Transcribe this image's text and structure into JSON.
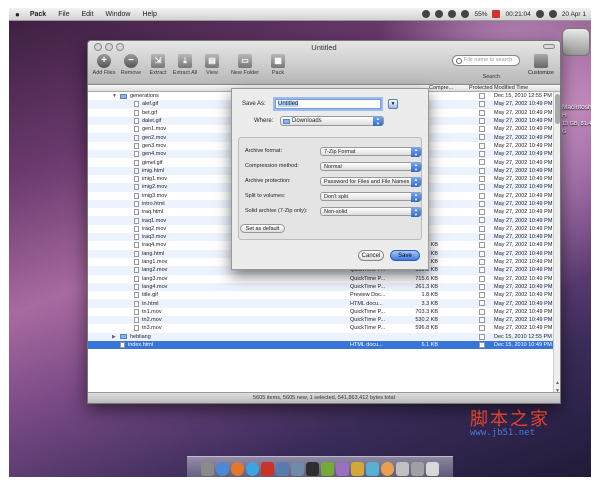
{
  "menubar": {
    "app": "Pack",
    "menus": [
      "File",
      "Edit",
      "Window",
      "Help"
    ],
    "battery": "55%",
    "clock": "00:21:04",
    "date": "20 Apr 1"
  },
  "desktop": {
    "drive_label_1": "Macintosh H",
    "drive_label_2": "13 GB, 81.4 G"
  },
  "window": {
    "title": "Untitled",
    "toolbar": [
      {
        "label": "Add Files",
        "glyph": "+"
      },
      {
        "label": "Remove",
        "glyph": "−"
      },
      {
        "label": "Extract",
        "glyph": "⇲"
      },
      {
        "label": "Extract All",
        "glyph": "⤓"
      },
      {
        "label": "View",
        "glyph": "▤"
      },
      {
        "label": "New Folder",
        "glyph": "▭"
      },
      {
        "label": "Pack",
        "glyph": "▦"
      }
    ],
    "search_placeholder": "File name to search",
    "search_label": "Search",
    "customize_label": "Customize",
    "columns": {
      "compression": "Compre...",
      "protected": "Protected",
      "modified": "Modified Time"
    },
    "status": "5605 items, 5605 new, 1 selected, 541,863,412 bytes total"
  },
  "rows": [
    {
      "name": "generations",
      "folder": true,
      "open": true,
      "indent": 0,
      "kind": "",
      "size": "",
      "modified": "Dec 15, 2010 12:55 PM"
    },
    {
      "name": "alef.gif",
      "indent": 1,
      "kind": "",
      "size": "",
      "modified": "May 27, 2002 10:49 PM"
    },
    {
      "name": "bet.gif",
      "indent": 1,
      "kind": "",
      "size": "",
      "modified": "May 27, 2002 10:49 PM"
    },
    {
      "name": "dalet.gif",
      "indent": 1,
      "kind": "",
      "size": "",
      "modified": "May 27, 2002 10:49 PM"
    },
    {
      "name": "gen1.mov",
      "indent": 1,
      "kind": "",
      "size": "",
      "modified": "May 27, 2002 10:49 PM"
    },
    {
      "name": "gen2.mov",
      "indent": 1,
      "kind": "",
      "size": "",
      "modified": "May 27, 2002 10:49 PM"
    },
    {
      "name": "gen3.mov",
      "indent": 1,
      "kind": "",
      "size": "",
      "modified": "May 27, 2002 10:49 PM"
    },
    {
      "name": "gen4.mov",
      "indent": 1,
      "kind": "",
      "size": "",
      "modified": "May 27, 2002 10:49 PM"
    },
    {
      "name": "gimel.gif",
      "indent": 1,
      "kind": "",
      "size": "",
      "modified": "May 27, 2002 10:49 PM"
    },
    {
      "name": "imig.html",
      "indent": 1,
      "kind": "",
      "size": "",
      "modified": "May 27, 2002 10:49 PM"
    },
    {
      "name": "imig1.mov",
      "indent": 1,
      "kind": "",
      "size": "",
      "modified": "May 27, 2002 10:49 PM"
    },
    {
      "name": "imig2.mov",
      "indent": 1,
      "kind": "",
      "size": "",
      "modified": "May 27, 2002 10:49 PM"
    },
    {
      "name": "imig3.mov",
      "indent": 1,
      "kind": "",
      "size": "",
      "modified": "May 27, 2002 10:49 PM"
    },
    {
      "name": "intro.html",
      "indent": 1,
      "kind": "",
      "size": "",
      "modified": "May 27, 2002 10:49 PM"
    },
    {
      "name": "iraq.html",
      "indent": 1,
      "kind": "",
      "size": "",
      "modified": "May 27, 2002 10:49 PM"
    },
    {
      "name": "iraq1.mov",
      "indent": 1,
      "kind": "",
      "size": "",
      "modified": "May 27, 2002 10:49 PM"
    },
    {
      "name": "iraq2.mov",
      "indent": 1,
      "kind": "",
      "size": "",
      "modified": "May 27, 2002 10:49 PM"
    },
    {
      "name": "iraq3.mov",
      "indent": 1,
      "kind": "",
      "size": "",
      "modified": "May 27, 2002 10:49 PM"
    },
    {
      "name": "iraq4.mov",
      "indent": 1,
      "kind": "QuickTime P...",
      "size": "400.1 KB",
      "modified": "May 27, 2002 10:49 PM"
    },
    {
      "name": "lang.html",
      "indent": 1,
      "kind": "HTML docu...",
      "size": "4.1 KB",
      "modified": "May 27, 2002 10:49 PM"
    },
    {
      "name": "lang1.mov",
      "indent": 1,
      "kind": "QuickTime P...",
      "size": "555.8 KB",
      "modified": "May 27, 2002 10:49 PM"
    },
    {
      "name": "lang2.mov",
      "indent": 1,
      "kind": "QuickTime P...",
      "size": "323.3 KB",
      "modified": "May 27, 2002 10:49 PM"
    },
    {
      "name": "lang3.mov",
      "indent": 1,
      "kind": "QuickTime P...",
      "size": "715.6 KB",
      "modified": "May 27, 2002 10:49 PM"
    },
    {
      "name": "lang4.mov",
      "indent": 1,
      "kind": "QuickTime P...",
      "size": "261.3 KB",
      "modified": "May 27, 2002 10:49 PM"
    },
    {
      "name": "title.gif",
      "indent": 1,
      "kind": "Preview Doc...",
      "size": "1.8 KB",
      "modified": "May 27, 2002 10:49 PM"
    },
    {
      "name": "tn.html",
      "indent": 1,
      "kind": "HTML docu...",
      "size": "3.3 KB",
      "modified": "May 27, 2002 10:49 PM"
    },
    {
      "name": "tn1.mov",
      "indent": 1,
      "kind": "QuickTime P...",
      "size": "703.3 KB",
      "modified": "May 27, 2002 10:49 PM"
    },
    {
      "name": "tn2.mov",
      "indent": 1,
      "kind": "QuickTime P...",
      "size": "530.2 KB",
      "modified": "May 27, 2002 10:49 PM"
    },
    {
      "name": "tn3.mov",
      "indent": 1,
      "kind": "QuickTime P...",
      "size": "596.8 KB",
      "modified": "May 27, 2002 10:49 PM"
    },
    {
      "name": "hebliang",
      "folder": true,
      "open": false,
      "indent": 0,
      "kind": "",
      "size": "",
      "modified": "Dec 15, 2010 12:55 PM"
    },
    {
      "name": "index.html",
      "indent": 0,
      "selected": true,
      "kind": "HTML docu...",
      "size": "6.1 KB",
      "modified": "Dec 15, 2010 10:49 PM"
    }
  ],
  "save_sheet": {
    "save_as_label": "Save As:",
    "filename": "Untitled",
    "where_label": "Where:",
    "where_value": "Downloads",
    "options": [
      {
        "label": "Archive format:",
        "value": "7-Zip Format"
      },
      {
        "label": "Compression method:",
        "value": "Normal"
      },
      {
        "label": "Archive protection:",
        "value": "Password for Files and File Names"
      },
      {
        "label": "Split to volumes:",
        "value": "Don't split"
      },
      {
        "label": "Solid archive (7-Zip only):",
        "value": "Non-solid"
      }
    ],
    "set_default": "Set as default",
    "cancel": "Cancel",
    "save": "Save"
  },
  "watermark": {
    "cn": "脚本之家",
    "url": "www.jb51.net"
  },
  "colors": {
    "selection": "#3875d7",
    "alt_row": "#edf3fe",
    "accent": "#3f7be0"
  }
}
